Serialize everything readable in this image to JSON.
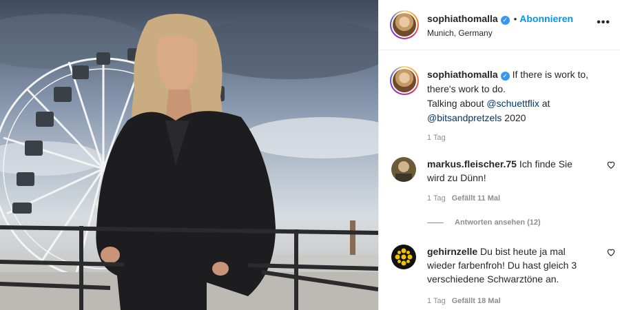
{
  "post": {
    "author": "sophiathomalla",
    "verified": true,
    "follow_label": "Abonnieren",
    "location": "Munich, Germany",
    "more_label": "•••"
  },
  "caption": {
    "author": "sophiathomalla",
    "text_1": "If there is work to, there's work to do.",
    "text_2": "Talking about ",
    "mention_1": "@schuettflix",
    "text_3": " at",
    "mention_2": "@bitsandpretzels",
    "text_4": " 2020",
    "time": "1 Tag"
  },
  "comments": [
    {
      "author": "markus.fleischer.75",
      "text": "Ich finde Sie wird zu Dünn!",
      "time": "1 Tag",
      "likes": "Gefällt 11 Mal",
      "view_replies": "Antworten ansehen (12)"
    },
    {
      "author": "gehirnzelle",
      "text": "Du bist heute ja mal wieder farbenfroh! Du hast gleich 3 verschiedene Schwarztöne an.",
      "time": "1 Tag",
      "likes": "Gefällt 18 Mal"
    }
  ],
  "colors": {
    "link": "#00376b",
    "follow": "#0095f6",
    "muted": "#8e8e8e"
  }
}
